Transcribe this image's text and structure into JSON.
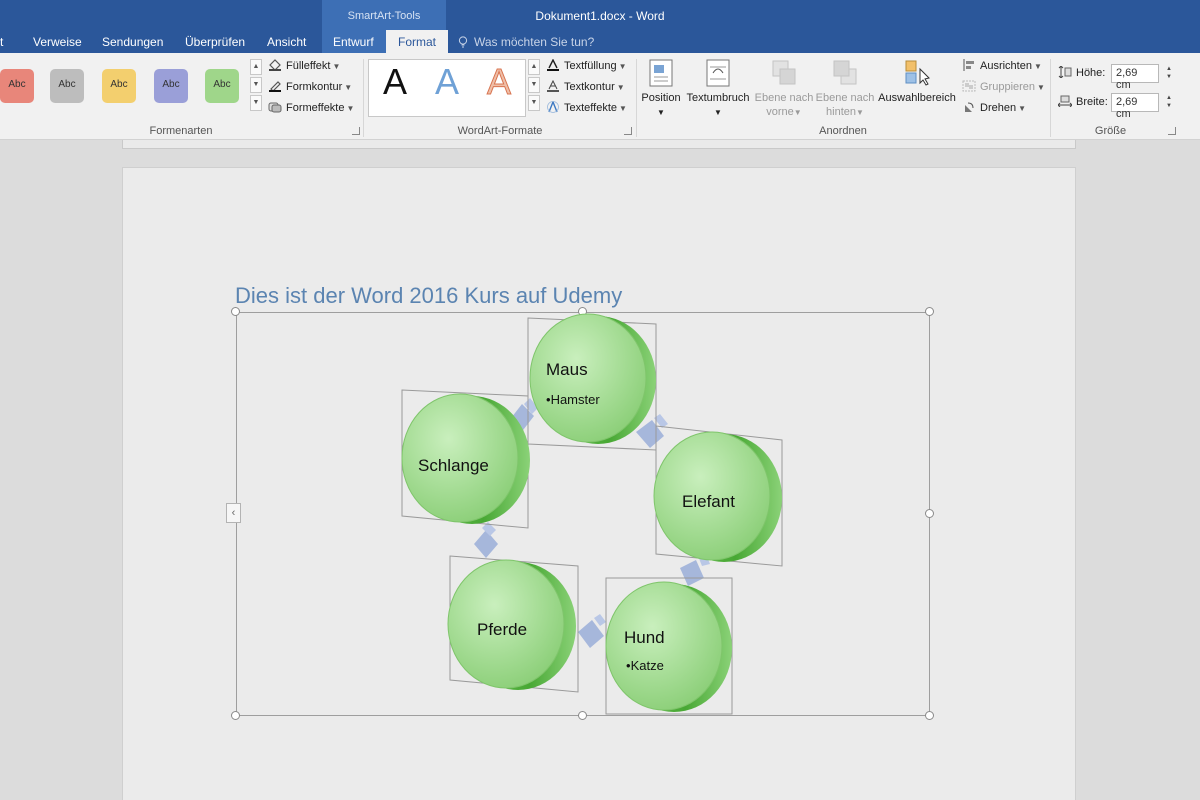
{
  "window": {
    "doc_title": "Dokument1.docx - Word",
    "context_group": "SmartArt-Tools",
    "tell_me": "Was möchten Sie tun?"
  },
  "tabs": [
    {
      "label": "t"
    },
    {
      "label": "Verweise"
    },
    {
      "label": "Sendungen"
    },
    {
      "label": "Überprüfen"
    },
    {
      "label": "Ansicht"
    },
    {
      "label": "Entwurf"
    },
    {
      "label": "Format"
    }
  ],
  "ribbon": {
    "formenarten": {
      "label": "Formenarten",
      "swatches": [
        {
          "text": "Abc",
          "color": "#e8867a"
        },
        {
          "text": "Abc",
          "color": "#bdbdbd"
        },
        {
          "text": "Abc",
          "color": "#f3cf6e"
        },
        {
          "text": "Abc",
          "color": "#9a9fd8"
        },
        {
          "text": "Abc",
          "color": "#9fd68a"
        }
      ],
      "fill": "Fülleffekt",
      "outline": "Formkontur",
      "effects": "Formeffekte"
    },
    "wordart": {
      "label": "WordArt-Formate",
      "letters": [
        "A",
        "A",
        "A"
      ],
      "text_fill": "Textfüllung",
      "text_outline": "Textkontur",
      "text_effects": "Texteffekte"
    },
    "anordnen": {
      "label": "Anordnen",
      "position": "Position",
      "wrap": "Textumbruch",
      "bring_forward_1": "Ebene nach",
      "bring_forward_2": "vorne",
      "send_backward_1": "Ebene nach",
      "send_backward_2": "hinten",
      "selection_pane": "Auswahlbereich",
      "align": "Ausrichten",
      "group": "Gruppieren",
      "rotate": "Drehen"
    },
    "groesse": {
      "label": "Größe",
      "height_label": "Höhe:",
      "height_value": "2,69 cm",
      "width_label": "Breite:",
      "width_value": "2,69 cm"
    }
  },
  "document": {
    "heading": "Dies ist der Word 2016 Kurs auf Udemy"
  },
  "smartart": {
    "node_fill": "#96d886",
    "node_side": "#5fb94a",
    "arrow_color": "#9fb1d9",
    "nodes": [
      {
        "label": "Maus",
        "sub": "Hamster"
      },
      {
        "label": "Elefant",
        "sub": ""
      },
      {
        "label": "Hund",
        "sub": "Katze"
      },
      {
        "label": "Pferde",
        "sub": ""
      },
      {
        "label": "Schlange",
        "sub": ""
      }
    ]
  }
}
